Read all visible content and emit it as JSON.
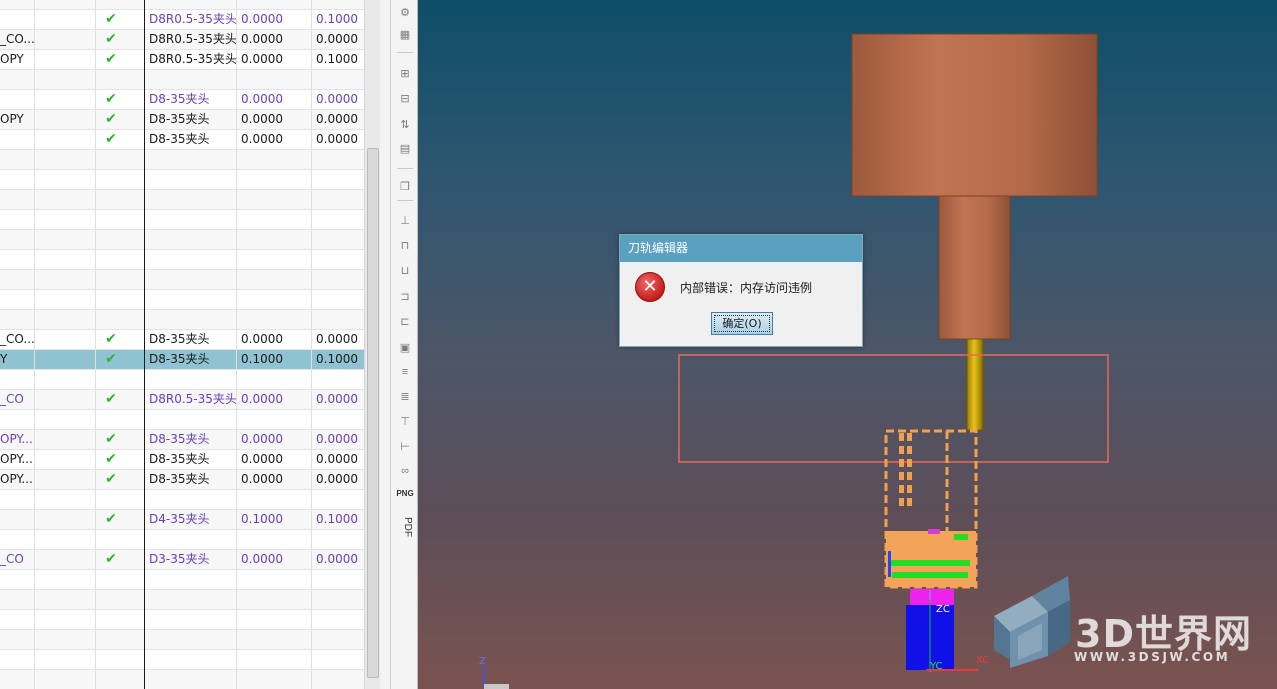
{
  "table": {
    "rows": [
      {
        "name": "",
        "check": "✔",
        "tool": "D8R0.5-35夹头",
        "v1": "0.0000",
        "v2": "0.1000",
        "style": "purple"
      },
      {
        "name": "_CO...",
        "check": "✔",
        "tool": "D8R0.5-35夹头",
        "v1": "0.0000",
        "v2": "0.0000",
        "style": ""
      },
      {
        "name": "OPY",
        "check": "✔",
        "tool": "D8R0.5-35夹头",
        "v1": "0.0000",
        "v2": "0.1000",
        "style": ""
      },
      {
        "name": "",
        "check": "",
        "tool": "",
        "v1": "",
        "v2": "",
        "style": ""
      },
      {
        "name": "",
        "check": "✔",
        "tool": "D8-35夹头",
        "v1": "0.0000",
        "v2": "0.0000",
        "style": "purple"
      },
      {
        "name": "OPY",
        "check": "✔",
        "tool": "D8-35夹头",
        "v1": "0.0000",
        "v2": "0.0000",
        "style": ""
      },
      {
        "name": "",
        "check": "✔",
        "tool": "D8-35夹头",
        "v1": "0.0000",
        "v2": "0.0000",
        "style": ""
      },
      {
        "name": "",
        "check": "",
        "tool": "",
        "v1": "",
        "v2": "",
        "style": ""
      },
      {
        "name": "",
        "check": "",
        "tool": "",
        "v1": "",
        "v2": "",
        "style": ""
      },
      {
        "name": "",
        "check": "",
        "tool": "",
        "v1": "",
        "v2": "",
        "style": ""
      },
      {
        "name": "",
        "check": "",
        "tool": "",
        "v1": "",
        "v2": "",
        "style": ""
      },
      {
        "name": "",
        "check": "",
        "tool": "",
        "v1": "",
        "v2": "",
        "style": ""
      },
      {
        "name": "",
        "check": "",
        "tool": "",
        "v1": "",
        "v2": "",
        "style": ""
      },
      {
        "name": "",
        "check": "",
        "tool": "",
        "v1": "",
        "v2": "",
        "style": ""
      },
      {
        "name": "",
        "check": "",
        "tool": "",
        "v1": "",
        "v2": "",
        "style": ""
      },
      {
        "name": "",
        "check": "",
        "tool": "",
        "v1": "",
        "v2": "",
        "style": ""
      },
      {
        "name": "_CO...",
        "check": "✔",
        "tool": "D8-35夹头",
        "v1": "0.0000",
        "v2": "0.0000",
        "style": ""
      },
      {
        "name": "Y",
        "check": "✔",
        "tool": "D8-35夹头",
        "v1": "0.1000",
        "v2": "0.1000",
        "style": "selected"
      },
      {
        "name": "",
        "check": "",
        "tool": "",
        "v1": "",
        "v2": "",
        "style": ""
      },
      {
        "name": "_CO",
        "check": "✔",
        "tool": "D8R0.5-35夹头",
        "v1": "0.0000",
        "v2": "0.0000",
        "style": "purple"
      },
      {
        "name": "",
        "check": "",
        "tool": "",
        "v1": "",
        "v2": "",
        "style": ""
      },
      {
        "name": "OPY...",
        "check": "✔",
        "tool": "D8-35夹头",
        "v1": "0.0000",
        "v2": "0.0000",
        "style": "purple"
      },
      {
        "name": "OPY...",
        "check": "✔",
        "tool": "D8-35夹头",
        "v1": "0.0000",
        "v2": "0.0000",
        "style": ""
      },
      {
        "name": "OPY...",
        "check": "✔",
        "tool": "D8-35夹头",
        "v1": "0.0000",
        "v2": "0.0000",
        "style": ""
      },
      {
        "name": "",
        "check": "",
        "tool": "",
        "v1": "",
        "v2": "",
        "style": ""
      },
      {
        "name": "",
        "check": "✔",
        "tool": "D4-35夹头",
        "v1": "0.1000",
        "v2": "0.1000",
        "style": "purple"
      },
      {
        "name": "",
        "check": "",
        "tool": "",
        "v1": "",
        "v2": "",
        "style": ""
      },
      {
        "name": "_CO",
        "check": "✔",
        "tool": "D3-35夹头",
        "v1": "0.0000",
        "v2": "0.0000",
        "style": "purple"
      },
      {
        "name": "",
        "check": "",
        "tool": "",
        "v1": "",
        "v2": "",
        "style": ""
      },
      {
        "name": "",
        "check": "",
        "tool": "",
        "v1": "",
        "v2": "",
        "style": ""
      },
      {
        "name": "",
        "check": "",
        "tool": "",
        "v1": "",
        "v2": "",
        "style": ""
      },
      {
        "name": "",
        "check": "",
        "tool": "",
        "v1": "",
        "v2": "",
        "style": ""
      },
      {
        "name": "",
        "check": "",
        "tool": "",
        "v1": "",
        "v2": "",
        "style": ""
      },
      {
        "name": "",
        "check": "",
        "tool": "",
        "v1": "",
        "v2": "",
        "style": ""
      }
    ]
  },
  "toolbar": {
    "icons": [
      "view-icon",
      "tree-icon",
      "branch-icon",
      "branch-alt-icon",
      "flip-icon",
      "stack-icon",
      "copy-icon",
      "tool-icon",
      "holder-icon",
      "drill-icon",
      "mill-icon",
      "lathe-icon",
      "sheet-icon",
      "layer-icon",
      "layer-alt-icon",
      "shaft-icon",
      "probe-icon",
      "glasses-icon"
    ],
    "png_label": "PNG",
    "pdf_label": "PDF"
  },
  "dialog": {
    "title": "刀轨编辑器",
    "message": "内部错误：内存访问违例",
    "ok_label": "确定(O)",
    "icon": "error-icon"
  },
  "viewport": {
    "axis_z": "Z",
    "axis_x": "XC",
    "axis_y": "YC",
    "axis_zc": "ZC"
  },
  "watermark": {
    "brand": "3D世界网",
    "url": "WWW.3DSJW.COM"
  },
  "colors": {
    "spindle": "#b46b48",
    "tool": "#c9a400",
    "stock_box": "#e06050",
    "fixture": "#f0a050",
    "selected_row": "#8fc3d1",
    "purple_text": "#6a3fb5",
    "check": "#2db52d",
    "dialog_title": "#5aa1c0"
  }
}
